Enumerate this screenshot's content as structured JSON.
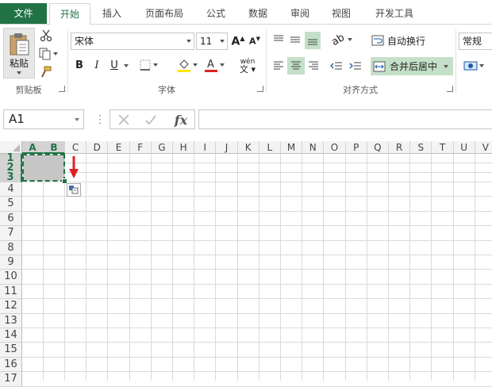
{
  "tabs": [
    "文件",
    "开始",
    "插入",
    "页面布局",
    "公式",
    "数据",
    "审阅",
    "视图",
    "开发工具"
  ],
  "ribbon": {
    "clipboard": {
      "paste_label": "粘贴",
      "group_label": "剪贴板"
    },
    "font": {
      "font_name": "宋体",
      "font_size": "11",
      "bold": "B",
      "italic": "I",
      "underline": "U",
      "phonetic": "wén",
      "group_label": "字体"
    },
    "alignment": {
      "wrap_text": "自动换行",
      "merge_center": "合并后居中",
      "group_label": "对齐方式"
    },
    "number": {
      "format": "常规"
    }
  },
  "formula_bar": {
    "name_box": "A1",
    "fx": "fx",
    "formula": ""
  },
  "grid": {
    "columns": [
      "A",
      "B",
      "C",
      "D",
      "E",
      "F",
      "G",
      "H",
      "I",
      "J",
      "K",
      "L",
      "M",
      "N",
      "O",
      "P",
      "Q",
      "R",
      "S",
      "T",
      "U",
      "V"
    ],
    "rows": [
      "1",
      "2",
      "3",
      "4",
      "5",
      "6",
      "7",
      "8",
      "9",
      "10",
      "11",
      "12",
      "13",
      "14",
      "15",
      "16",
      "17"
    ]
  },
  "colors": {
    "accent": "#217346",
    "selection": "#c5e0c8",
    "arrow": "#e02020"
  }
}
